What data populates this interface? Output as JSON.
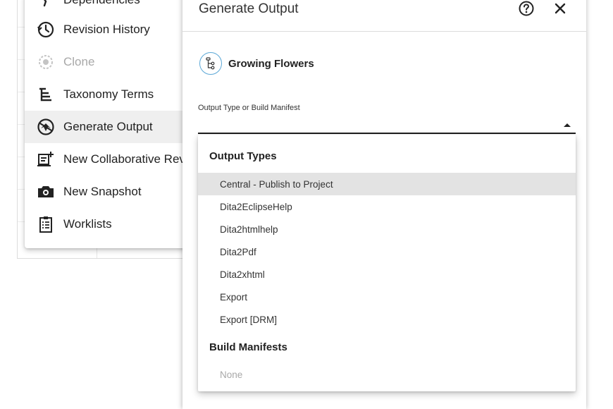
{
  "menu": {
    "items": [
      {
        "label": "Dependencies",
        "icon": "dependencies-icon",
        "state": "normal"
      },
      {
        "label": "Revision History",
        "icon": "history-icon",
        "state": "normal"
      },
      {
        "label": "Clone",
        "icon": "clone-icon",
        "state": "disabled"
      },
      {
        "label": "Taxonomy Terms",
        "icon": "taxonomy-icon",
        "state": "normal"
      },
      {
        "label": "Generate Output",
        "icon": "generate-output-icon",
        "state": "active"
      },
      {
        "label": "New Collaborative Revi",
        "icon": "collaborative-review-icon",
        "state": "normal"
      },
      {
        "label": "New Snapshot",
        "icon": "camera-icon",
        "state": "normal"
      },
      {
        "label": "Worklists",
        "icon": "worklist-icon",
        "state": "normal"
      }
    ]
  },
  "dialog": {
    "title": "Generate Output",
    "help_icon": "help-circle-icon",
    "close_icon": "close-icon",
    "document_title": "Growing Flowers",
    "document_icon": "map-tree-icon",
    "field_label": "Output Type or Build Manifest"
  },
  "dropdown": {
    "output_types_heading": "Output Types",
    "output_types": [
      "Central - Publish to Project",
      "Dita2EclipseHelp",
      "Dita2htmlhelp",
      "Dita2Pdf",
      "Dita2xhtml",
      "Export",
      "Export [DRM]"
    ],
    "build_manifests_heading": "Build Manifests",
    "build_manifests": [
      "None"
    ]
  },
  "colors": {
    "accent": "#5aa7d6",
    "highlight": "#e3e3e3",
    "active_menu": "#efefef",
    "disabled_text": "#a8a8a8"
  }
}
